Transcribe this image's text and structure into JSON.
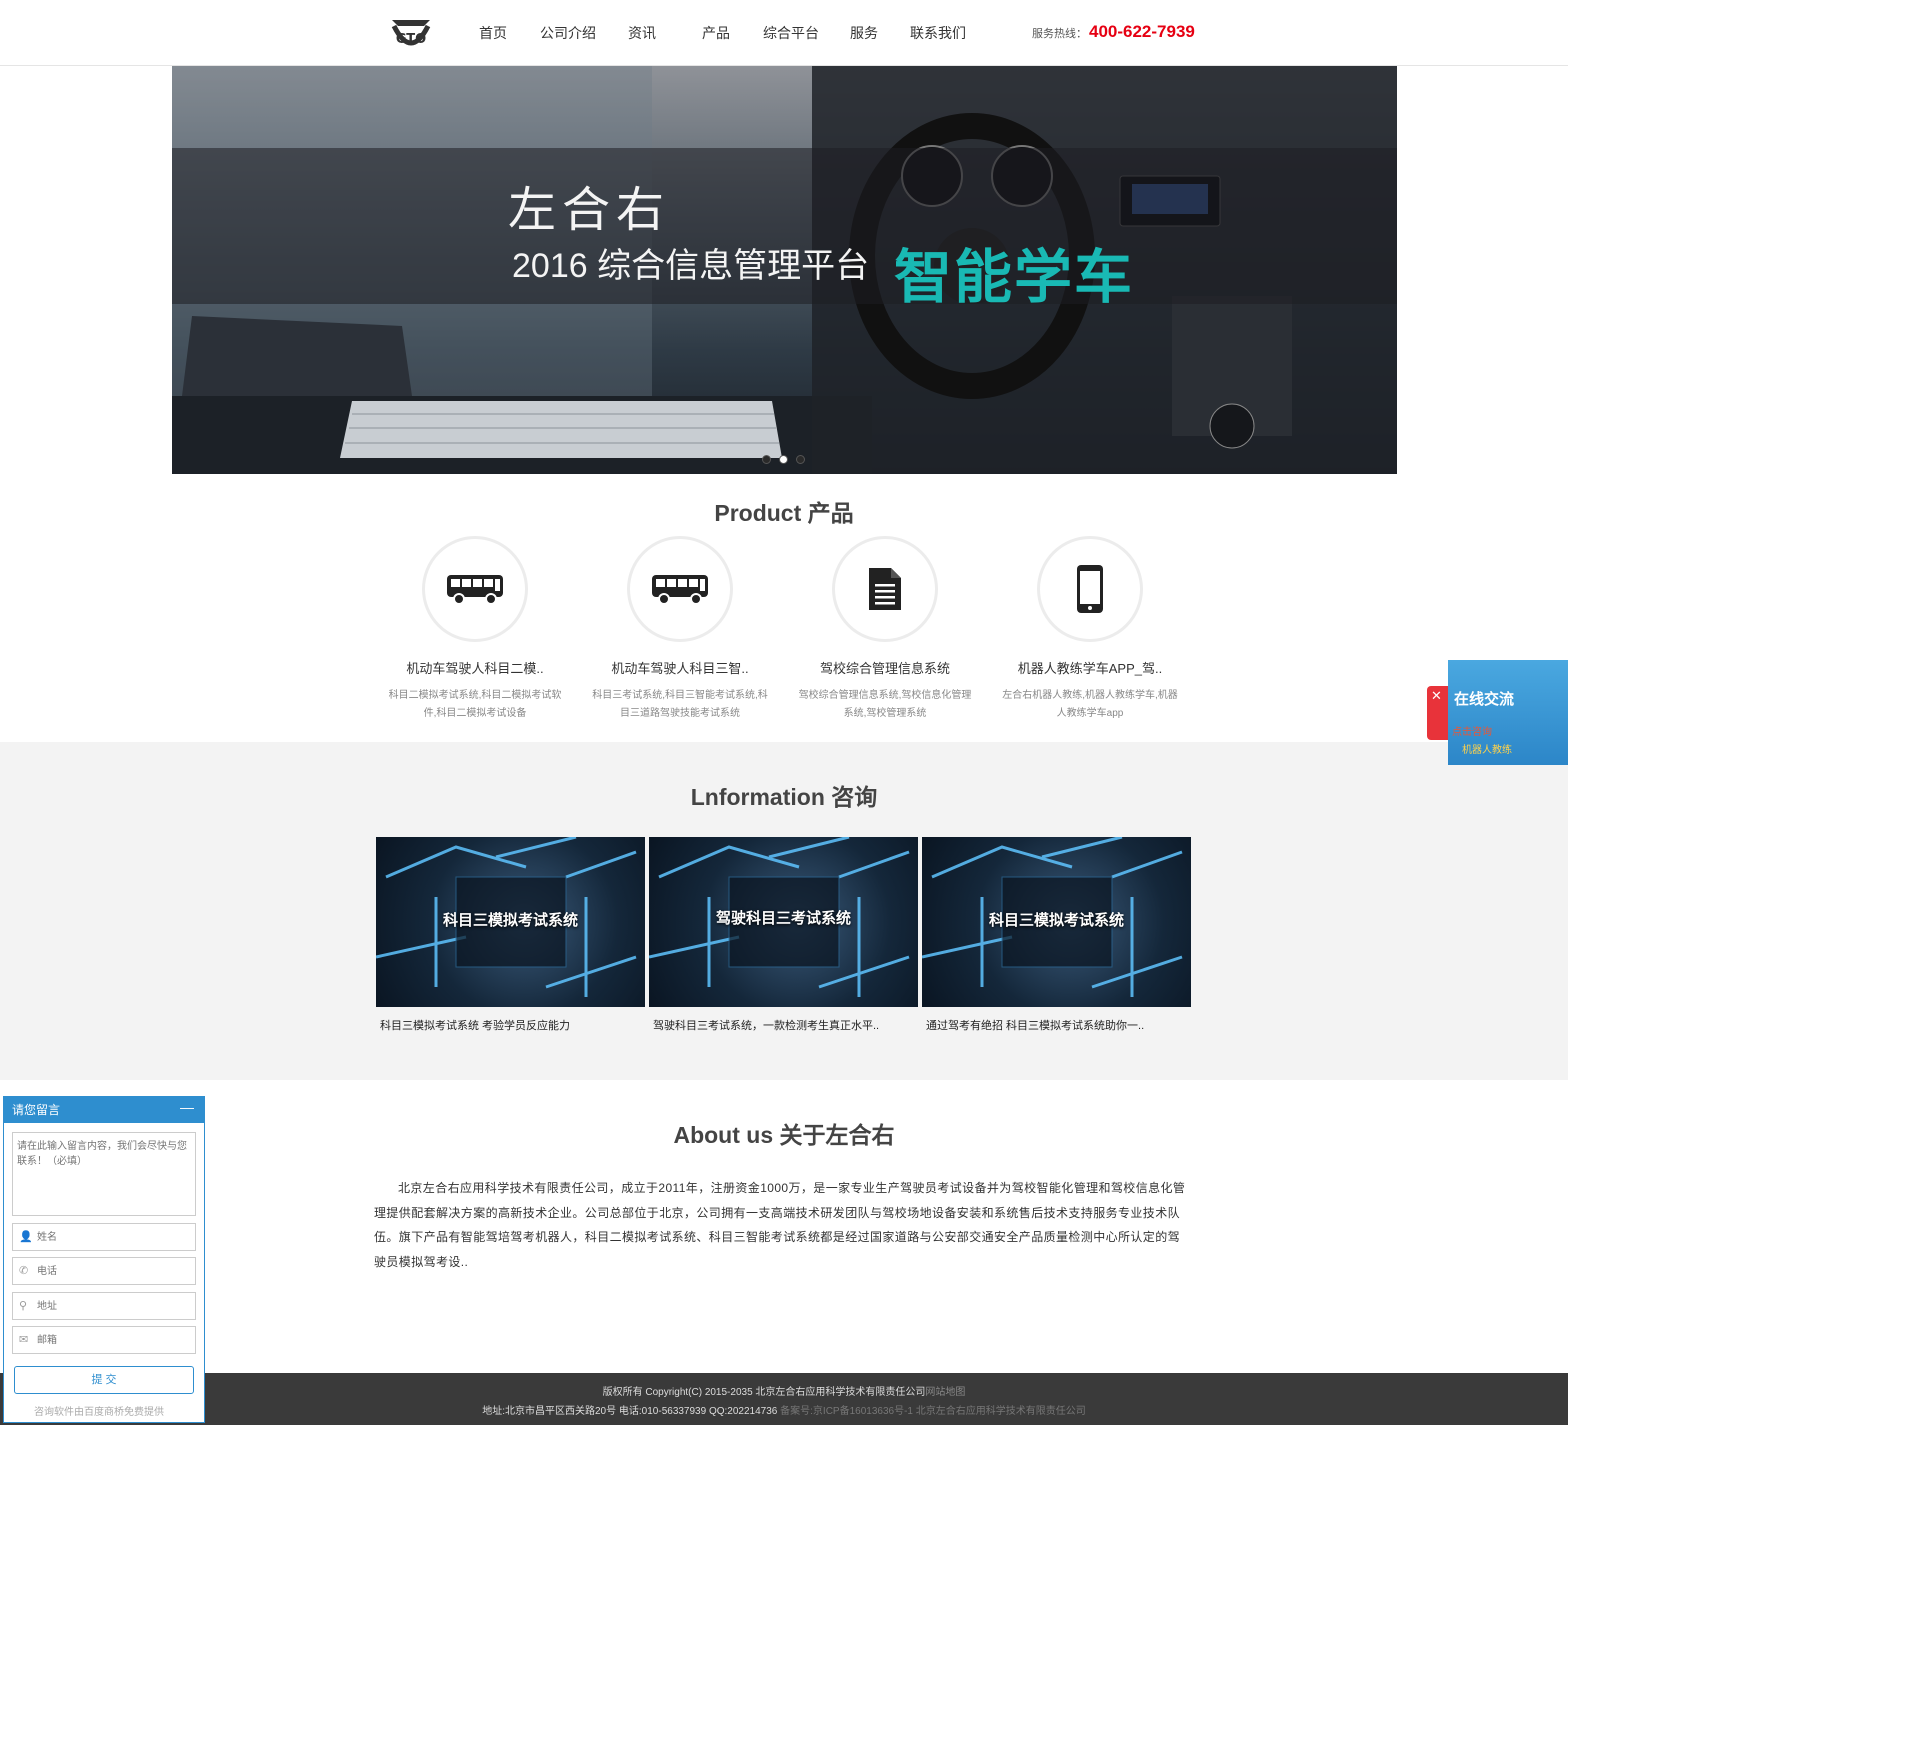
{
  "header": {
    "nav": [
      "首页",
      "公司介绍",
      "资讯",
      "产品",
      "综合平台",
      "服务",
      "联系我们"
    ],
    "hotline_label": "服务热线：",
    "hotline_number": "400-622-7939"
  },
  "banner": {
    "title": "左合右",
    "subtitle": "2016 综合信息管理平台",
    "accent": "智能学车",
    "accent_color": "#19b9b4",
    "active_slide": 2
  },
  "product": {
    "title": "Product 产品",
    "items": [
      {
        "icon": "bus-icon",
        "name": "机动车驾驶人科目二模..",
        "desc": "科目二模拟考试系统,科目二模拟考试软件,科目二模拟考试设备"
      },
      {
        "icon": "bus-icon",
        "name": "机动车驾驶人科目三智..",
        "desc": "科目三考试系统,科目三智能考试系统,科目三道路驾驶技能考试系统"
      },
      {
        "icon": "document-icon",
        "name": "驾校综合管理信息系统",
        "desc": "驾校综合管理信息系统,驾校信息化管理系统,驾校管理系统"
      },
      {
        "icon": "phone-icon",
        "name": "机器人教练学车APP_驾..",
        "desc": "左合右机器人教练,机器人教练学车,机器人教练学车app"
      }
    ]
  },
  "info": {
    "title": "Lnformation 咨询",
    "cards": [
      {
        "caption": "科目三模拟考试系统",
        "text": "科目三模拟考试系统 考验学员反应能力"
      },
      {
        "caption": "驾驶科目三考试系统",
        "text": "驾驶科目三考试系统，一款检测考生真正水平.."
      },
      {
        "caption": "科目三模拟考试系统",
        "text": "通过驾考有绝招 科目三模拟考试系统助你一.."
      }
    ]
  },
  "about": {
    "title": "About us 关于左合右",
    "text": "北京左合右应用科学技术有限责任公司，成立于2011年，注册资金1000万，是一家专业生产驾驶员考试设备并为驾校智能化管理和驾校信息化管理提供配套解决方案的高新技术企业。公司总部位于北京，公司拥有一支高端技术研发团队与驾校场地设备安装和系统售后技术支持服务专业技术队伍。旗下产品有智能驾培驾考机器人，科目二模拟考试系统、科目三智能考试系统都是经过国家道路与公安部交通安全产品质量检测中心所认定的驾驶员模拟驾考设.."
  },
  "footer": {
    "copyright": "版权所有 Copyright(C) 2015-2035 北京左合右应用科学技术有限责任公司",
    "sitemap": "网站地图",
    "address": "地址:北京市昌平区西关路20号   电话:010-56337939   QQ:202214736",
    "icp": "备案号:京ICP备16013636号-1 北京左合右应用科学技术有限责任公司"
  },
  "chat_float": {
    "title": "在线交流",
    "sub": "点击咨询",
    "robot": "机器人教练"
  },
  "message_widget": {
    "header": "请您留言",
    "minimize": "—",
    "textarea_placeholder": "请在此输入留言内容，我们会尽快与您联系！（必填）",
    "name_placeholder": "姓名",
    "phone_placeholder": "电话",
    "address_placeholder": "地址",
    "email_placeholder": "邮箱",
    "submit": "提 交",
    "footer": "咨询软件由百度商桥免费提供"
  }
}
